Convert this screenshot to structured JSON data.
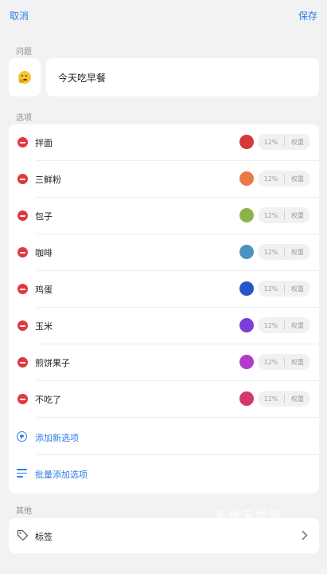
{
  "header": {
    "cancel_label": "取消",
    "save_label": "保存"
  },
  "question": {
    "section_label": "问题",
    "emoji_icon": "thinking-face-icon",
    "text": "今天吃早餐"
  },
  "options": {
    "section_label": "选项",
    "items": [
      {
        "label": "拌面",
        "color": "#d6393b",
        "weight_pct": "12%",
        "weight_label": "权重"
      },
      {
        "label": "三鲜粉",
        "color": "#ea7b45",
        "weight_pct": "12%",
        "weight_label": "权重"
      },
      {
        "label": "包子",
        "color": "#8db34a",
        "weight_pct": "12%",
        "weight_label": "权重"
      },
      {
        "label": "咖啡",
        "color": "#4a93c2",
        "weight_pct": "12%",
        "weight_label": "权重"
      },
      {
        "label": "鸡蛋",
        "color": "#2458c6",
        "weight_pct": "12%",
        "weight_label": "权重"
      },
      {
        "label": "玉米",
        "color": "#7e3cd8",
        "weight_pct": "12%",
        "weight_label": "权重"
      },
      {
        "label": "煎饼果子",
        "color": "#b23bc9",
        "weight_pct": "12%",
        "weight_label": "权重"
      },
      {
        "label": "不吃了",
        "color": "#d2386a",
        "weight_pct": "12%",
        "weight_label": "权重"
      }
    ],
    "add_label": "添加新选项",
    "batch_add_label": "批量添加选项"
  },
  "other": {
    "section_label": "其他",
    "tag_label": "标签"
  },
  "watermark": "系统天堂网",
  "colors": {
    "accent": "#2f7de1",
    "remove": "#e0383e",
    "background": "#f2f2f4"
  }
}
